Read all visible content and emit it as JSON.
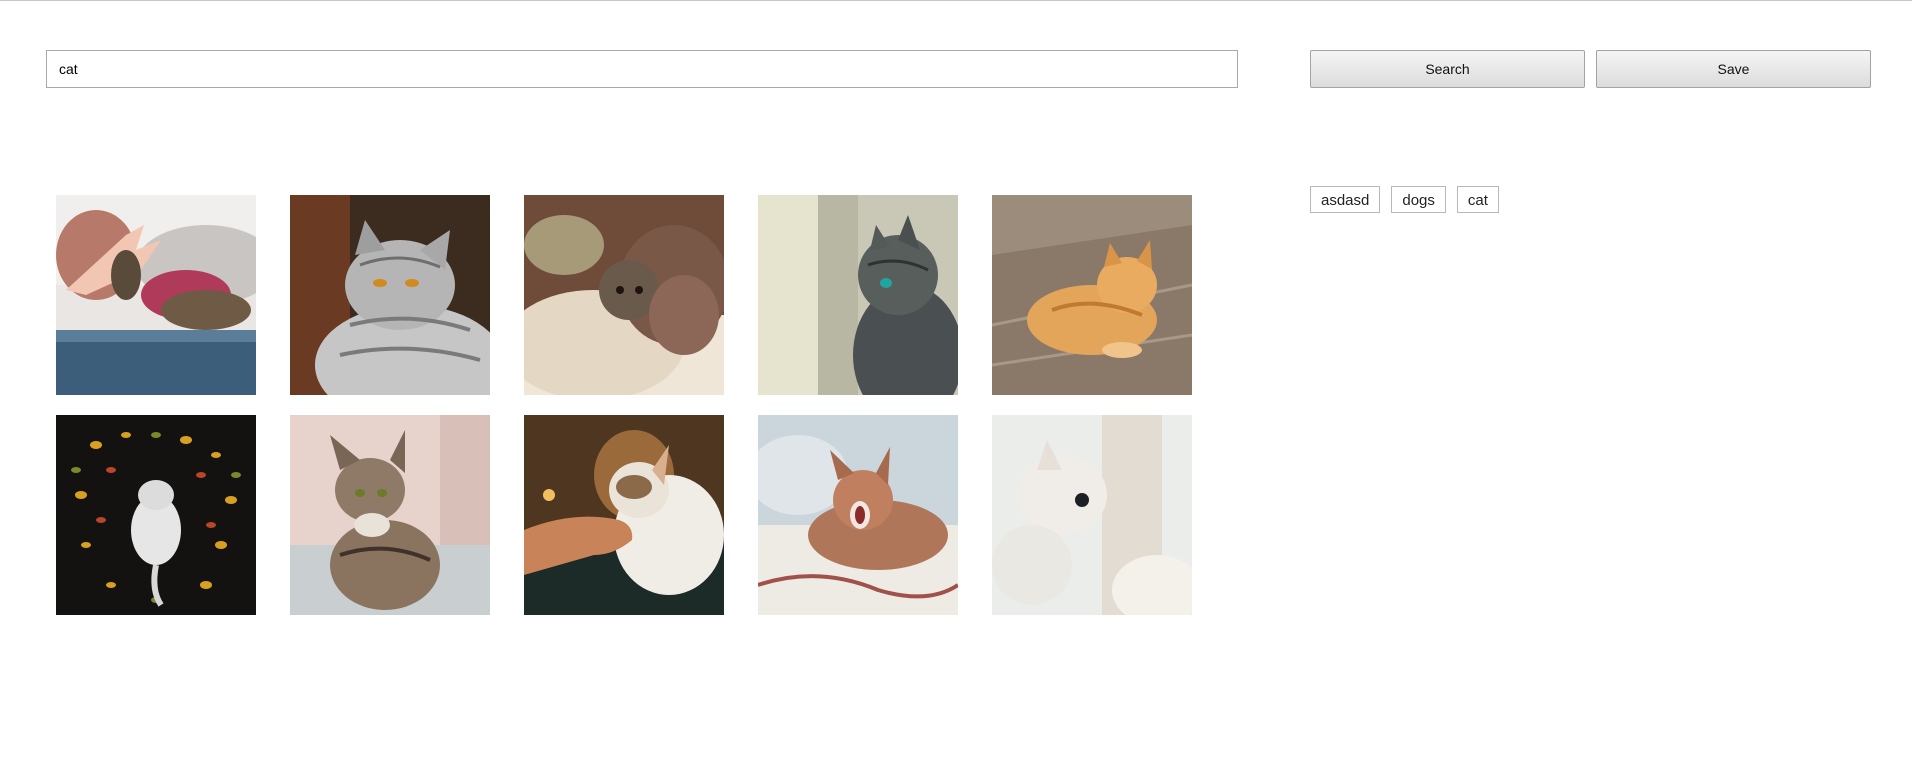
{
  "search": {
    "value": "cat",
    "search_label": "Search",
    "save_label": "Save"
  },
  "tags": [
    "asdasd",
    "dogs",
    "cat"
  ],
  "images": [
    {
      "name": "image-hand-highfive-cat"
    },
    {
      "name": "image-silver-tabby-cat"
    },
    {
      "name": "image-cat-under-blanket"
    },
    {
      "name": "image-grey-tabby-cat-profile"
    },
    {
      "name": "image-orange-cat-on-floor"
    },
    {
      "name": "image-white-kitten-with-leaves"
    },
    {
      "name": "image-tabby-kitten-on-couch"
    },
    {
      "name": "image-hand-petting-cat"
    },
    {
      "name": "image-yawning-ginger-cat"
    },
    {
      "name": "image-white-fluffy-cat"
    }
  ]
}
